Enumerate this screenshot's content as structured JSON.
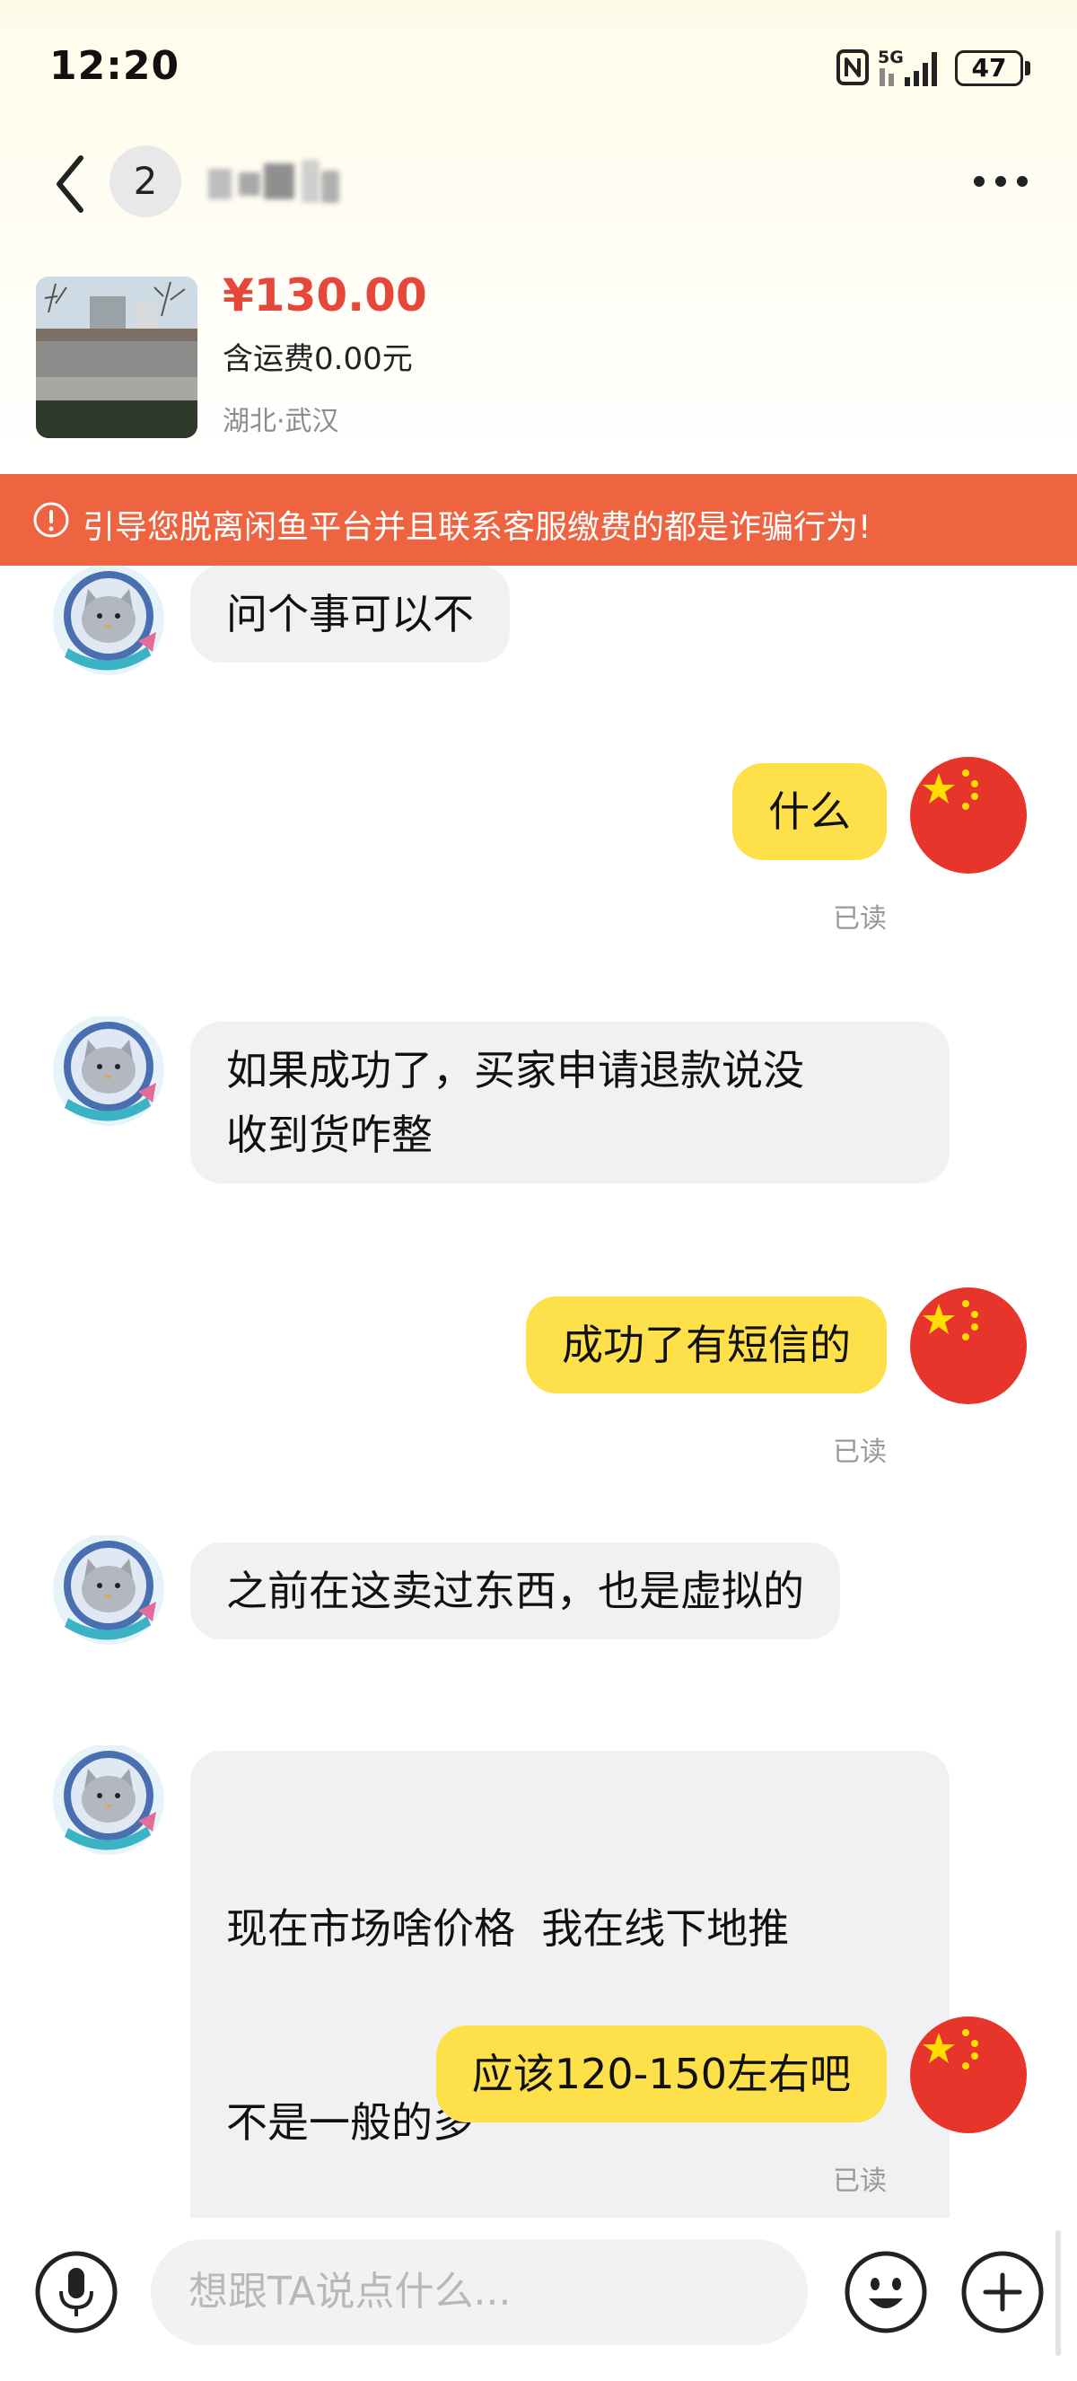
{
  "status_bar": {
    "time": "12:20",
    "network": "5G",
    "battery": "47"
  },
  "nav": {
    "unread_count": "2",
    "more_icon": "more-horizontal-icon",
    "back_icon": "chevron-left-icon"
  },
  "product": {
    "price": "¥130.00",
    "shipping": "含运费0.00元",
    "location": "湖北·武汉"
  },
  "warning": {
    "text": "引导您脱离闲鱼平台并且联系客服缴费的都是诈骗行为!",
    "icon": "alert-circle-icon"
  },
  "messages": [
    {
      "side": "in",
      "lines": [
        "问个事可以不"
      ]
    },
    {
      "side": "out",
      "lines": [
        "什么"
      ],
      "status": "已读"
    },
    {
      "side": "in",
      "lines": [
        "如果成功了，买家申请退款说没",
        "收到货咋整"
      ]
    },
    {
      "side": "out",
      "lines": [
        "成功了有短信的"
      ],
      "status": "已读"
    },
    {
      "side": "in",
      "lines": [
        "之前在这卖过东西，也是虚拟的"
      ]
    },
    {
      "side": "in",
      "lines": [
        "现在市场啥价格  我在线下地推",
        "不是一般的多"
      ]
    },
    {
      "side": "out",
      "lines": [
        "应该120-150左右吧"
      ],
      "status": "已读"
    }
  ],
  "input": {
    "placeholder": "想跟TA说点什么..."
  },
  "colors": {
    "warning_bg": "#ee6340",
    "price": "#e5483a",
    "outgoing_bubble": "#fee04b",
    "incoming_bubble": "#f1f1f4"
  }
}
